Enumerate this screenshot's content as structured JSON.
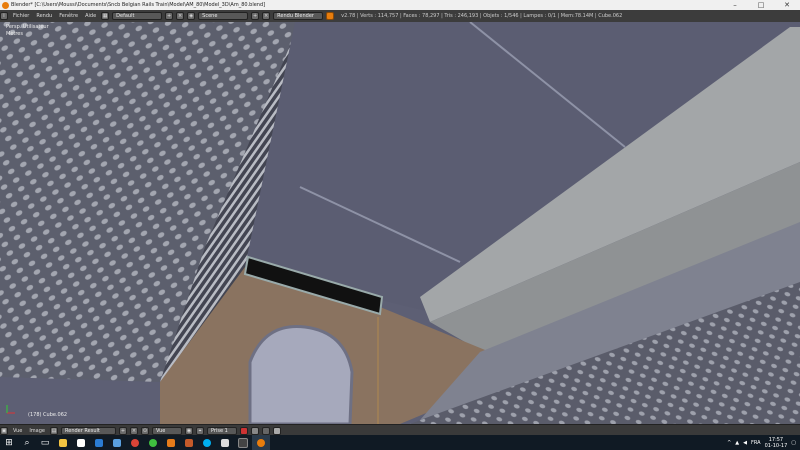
{
  "window": {
    "title": "Blender* [C:\\Users\\Moussi\\Documents\\Sncb Belgian Rails Train\\Model\\AM_80\\Model_3D\\Am_80.blend]",
    "minimize_icon": "minimize-icon",
    "maximize_icon": "maximize-icon",
    "close_icon": "close-icon"
  },
  "info_header": {
    "menus": [
      "Fichier",
      "Rendu",
      "Fenêtre",
      "Aide"
    ],
    "screen_layout": "Default",
    "scene": "Scene",
    "render_engine": "Rendu Blender",
    "stats": "v2.78 | Verts : 114,757 | Faces : 78,297 | Tris : 246,193 | Objets : 1/546 | Lampes : 0/1 | Mem:78.14M | Cube.062"
  },
  "viewport": {
    "view_label": "Persp. Utilisateur",
    "units_label": "Mètres",
    "object_label": "(178) Cube.062"
  },
  "bottom_header": {
    "menus": [
      "Vue",
      "Image"
    ],
    "image_name": "Render Result",
    "view_mode": "Vue",
    "layer": "Prise 1"
  },
  "taskbar": {
    "language": "FRA",
    "time": "17:57",
    "date": "01-10-17",
    "apps": [
      "windows-start",
      "search",
      "task-view",
      "file-explorer",
      "store",
      "mail",
      "photos",
      "chrome",
      "utorrent",
      "media",
      "onenote",
      "skype",
      "notepad",
      "explorer",
      "blender"
    ]
  },
  "colors": {
    "ceiling": "#5d5f74",
    "wall": "#8a7360",
    "panel_light": "#a3a6a8",
    "arch": "#a6a9bc"
  }
}
